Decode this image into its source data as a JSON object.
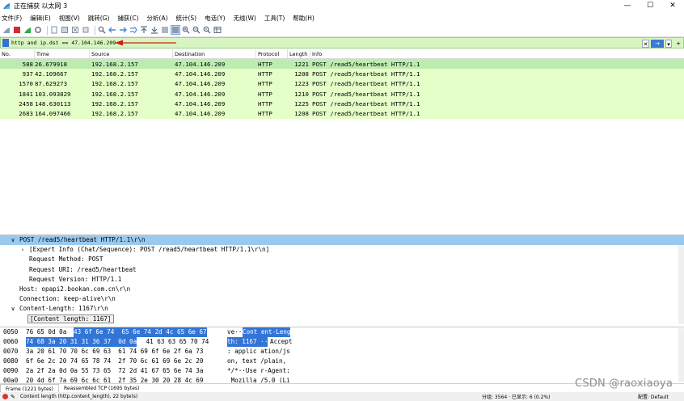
{
  "window": {
    "title": "正在捕获 以太网 3",
    "controls": [
      "—",
      "☐",
      "✕"
    ]
  },
  "menu": [
    "文件(F)",
    "编辑(E)",
    "视图(V)",
    "跳转(G)",
    "捕获(C)",
    "分析(A)",
    "统计(S)",
    "电话(Y)",
    "无线(W)",
    "工具(T)",
    "帮助(H)"
  ],
  "toolbar": {
    "icons": [
      "shark-fin-icon",
      "stop-icon",
      "restart-icon",
      "options-icon",
      "open-icon",
      "save-icon",
      "close-file-icon",
      "reload-icon",
      "find-icon",
      "back-icon",
      "forward-icon",
      "goto-icon",
      "first-icon",
      "last-icon",
      "autoscroll-icon",
      "colorize-icon",
      "zoom-in-icon",
      "zoom-out-icon",
      "zoom-reset-icon",
      "resize-columns-icon"
    ]
  },
  "filter": {
    "value": "http and ip.dst == 47.104.146.209",
    "clear_glyph": "✕",
    "apply_glyph": "→",
    "dropdown_glyph": "▾",
    "add_glyph": "+"
  },
  "packet_list": {
    "columns": [
      "No.",
      "Time",
      "Source",
      "Destination",
      "Protocol",
      "Length",
      "Info"
    ],
    "rows": [
      {
        "no": "588",
        "time": "26.679918",
        "src": "192.168.2.157",
        "dst": "47.104.146.209",
        "proto": "HTTP",
        "len": "1221",
        "info": "POST /read5/heartbeat HTTP/1.1",
        "selected": true
      },
      {
        "no": "937",
        "time": "42.109667",
        "src": "192.168.2.157",
        "dst": "47.104.146.209",
        "proto": "HTTP",
        "len": "1208",
        "info": "POST /read5/heartbeat HTTP/1.1"
      },
      {
        "no": "1570",
        "time": "87.629273",
        "src": "192.168.2.157",
        "dst": "47.104.146.209",
        "proto": "HTTP",
        "len": "1223",
        "info": "POST /read5/heartbeat HTTP/1.1"
      },
      {
        "no": "1841",
        "time": "103.093829",
        "src": "192.168.2.157",
        "dst": "47.104.146.209",
        "proto": "HTTP",
        "len": "1210",
        "info": "POST /read5/heartbeat HTTP/1.1"
      },
      {
        "no": "2458",
        "time": "148.630113",
        "src": "192.168.2.157",
        "dst": "47.104.146.209",
        "proto": "HTTP",
        "len": "1225",
        "info": "POST /read5/heartbeat HTTP/1.1"
      },
      {
        "no": "2683",
        "time": "164.097466",
        "src": "192.168.2.157",
        "dst": "47.104.146.209",
        "proto": "HTTP",
        "len": "1208",
        "info": "POST /read5/heartbeat HTTP/1.1"
      }
    ]
  },
  "details": [
    {
      "text": "POST /read5/heartbeat HTTP/1.1\\r\\n",
      "toggle": "∨",
      "indent": 0,
      "selected": true
    },
    {
      "text": "[Expert Info (Chat/Sequence): POST /read5/heartbeat HTTP/1.1\\r\\n]",
      "toggle": "›",
      "indent": 1
    },
    {
      "text": "Request Method: POST",
      "indent": 2
    },
    {
      "text": "Request URI: /read5/heartbeat",
      "indent": 2
    },
    {
      "text": "Request Version: HTTP/1.1",
      "indent": 2
    },
    {
      "text": "Host: opapi2.bookan.com.cn\\r\\n",
      "indent": 0
    },
    {
      "text": "Connection: keep-alive\\r\\n",
      "indent": 0
    },
    {
      "text": "Content-Length: 1167\\r\\n",
      "toggle": "∨",
      "indent": 0
    },
    {
      "text": "[Content length: 1167]",
      "indent": 1,
      "boxed": true
    }
  ],
  "bytes": [
    {
      "offset": "0050",
      "hex_pre": "76 65 0d 0a ",
      "hex_hl": "43 6f 6e 74  65 6e 74 2d 4c 65 6e 67",
      "hex_post": "",
      "ascii_pre": "ve··",
      "ascii_hl": "Cont ent-Leng",
      "ascii_post": ""
    },
    {
      "offset": "0060",
      "hex_pre": "",
      "hex_hl": "74 68 3a 20 31 31 36 37  0d 0a",
      "hex_post": " 41 63 63 65 70 74",
      "ascii_pre": "",
      "ascii_hl": "th: 1167 ··",
      "ascii_post": "Accept"
    },
    {
      "offset": "0070",
      "hex_pre": "3a 20 61 70 70 6c 69 63  61 74 69 6f 6e 2f 6a 73",
      "hex_hl": "",
      "hex_post": "",
      "ascii_pre": ": applic ation/js",
      "ascii_hl": "",
      "ascii_post": ""
    },
    {
      "offset": "0080",
      "hex_pre": "6f 6e 2c 20 74 65 78 74  2f 70 6c 61 69 6e 2c 20",
      "hex_hl": "",
      "hex_post": "",
      "ascii_pre": "on, text /plain,",
      "ascii_hl": "",
      "ascii_post": ""
    },
    {
      "offset": "0090",
      "hex_pre": "2a 2f 2a 0d 0a 55 73 65  72 2d 41 67 65 6e 74 3a",
      "hex_hl": "",
      "hex_post": "",
      "ascii_pre": "*/*··Use r-Agent:",
      "ascii_hl": "",
      "ascii_post": ""
    },
    {
      "offset": "00a0",
      "hex_pre": "20 4d 6f 7a 69 6c 6c 61  2f 35 2e 30 20 28 4c 69",
      "hex_hl": "",
      "hex_post": "",
      "ascii_pre": " Mozilla /5.0 (Li",
      "ascii_hl": "",
      "ascii_post": ""
    }
  ],
  "bottom_tabs": [
    "Frame (1221 bytes)",
    "Reassembled TCP (1695 bytes)"
  ],
  "status": {
    "text": "Content length (http.content_length), 22 byte(s)",
    "packets": "分组: 3564 · 已显示: 6 (0.2%)",
    "profile": "配置: Default"
  },
  "watermark": "CSDN @raoxiaoya",
  "colors": {
    "filter_bg": "#d7f5c0",
    "row_bg": "#e4ffc7",
    "row_selected": "#bdecb0",
    "detail_selected": "#99c9ef",
    "byte_highlight": "#3375d6",
    "arrow": "#d21a1a"
  }
}
